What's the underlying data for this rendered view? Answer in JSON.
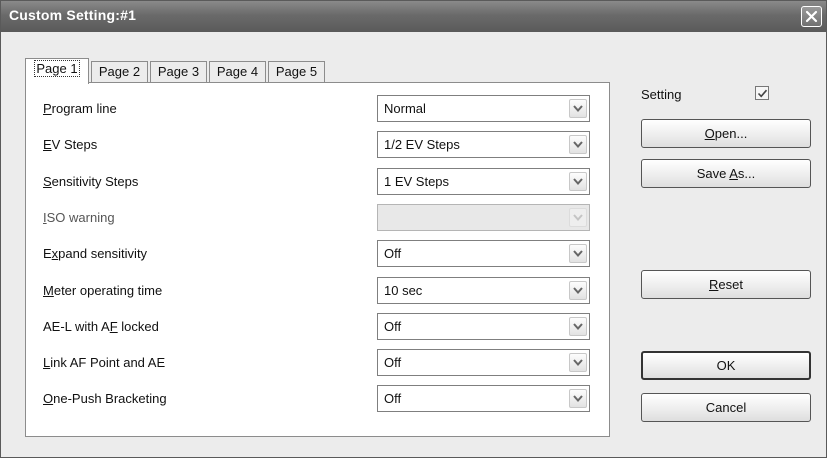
{
  "window": {
    "title": "Custom Setting:#1"
  },
  "tabs": [
    {
      "label": "Page 1",
      "active": true
    },
    {
      "label": "Page 2",
      "active": false
    },
    {
      "label": "Page 3",
      "active": false
    },
    {
      "label": "Page 4",
      "active": false
    },
    {
      "label": "Page 5",
      "active": false
    }
  ],
  "settings": [
    {
      "label": "Program line",
      "mnemonic": "P",
      "value": "Normal",
      "enabled": true
    },
    {
      "label": "EV Steps",
      "mnemonic": "E",
      "value": "1/2 EV Steps",
      "enabled": true
    },
    {
      "label": "Sensitivity Steps",
      "mnemonic": "S",
      "value": "1 EV Steps",
      "enabled": true
    },
    {
      "label": "ISO warning",
      "mnemonic": "I",
      "value": "",
      "enabled": false
    },
    {
      "label": "Expand sensitivity",
      "mnemonic": "x",
      "value": "Off",
      "enabled": true
    },
    {
      "label": "Meter operating time",
      "mnemonic": "M",
      "value": "10 sec",
      "enabled": true
    },
    {
      "label": "AE-L with AF locked",
      "mnemonic": "F",
      "value": "Off",
      "enabled": true
    },
    {
      "label": "Link AF Point and AE",
      "mnemonic": "L",
      "value": "Off",
      "enabled": true
    },
    {
      "label": "One-Push Bracketing",
      "mnemonic": "O",
      "value": "Off",
      "enabled": true
    }
  ],
  "side": {
    "setting_label": "Setting",
    "setting_checked": true,
    "open_label": "Open...",
    "save_as_label": "Save As...",
    "reset_label": "Reset",
    "ok_label": "OK",
    "cancel_label": "Cancel"
  },
  "icons": {
    "close": "close-icon",
    "dropdown": "chevron-down-icon",
    "check": "checkmark-icon"
  }
}
